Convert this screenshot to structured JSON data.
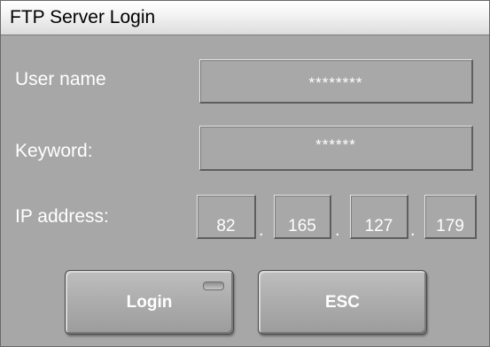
{
  "window": {
    "title": "FTP Server Login"
  },
  "form": {
    "username_label": "User name",
    "username_value": "********",
    "keyword_label": "Keyword:",
    "keyword_value": "******",
    "ip_label": "IP address:",
    "ip_octets": [
      "82",
      "165",
      "127",
      "179"
    ],
    "ip_separator": "."
  },
  "buttons": {
    "login_label": "Login",
    "esc_label": "ESC"
  },
  "colors": {
    "panel": "#a7a7a7",
    "text": "#ffffff"
  }
}
